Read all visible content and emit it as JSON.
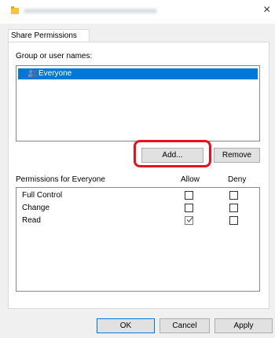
{
  "window": {
    "close_glyph": "×"
  },
  "tabs": [
    {
      "label": "Share Permissions"
    }
  ],
  "group_section": {
    "label": "Group or user names:",
    "items": [
      {
        "name": "Everyone",
        "icon": "users-icon",
        "selected": true
      }
    ]
  },
  "buttons": {
    "add": "Add...",
    "remove": "Remove",
    "ok": "OK",
    "cancel": "Cancel",
    "apply": "Apply"
  },
  "permissions": {
    "label": "Permissions for Everyone",
    "columns": {
      "allow": "Allow",
      "deny": "Deny"
    },
    "rows": [
      {
        "name": "Full Control",
        "allow": false,
        "deny": false
      },
      {
        "name": "Change",
        "allow": false,
        "deny": false
      },
      {
        "name": "Read",
        "allow": true,
        "deny": false
      }
    ]
  },
  "colors": {
    "selection": "#0078d7",
    "highlight": "#e8111d",
    "folder": "#f5c342"
  }
}
